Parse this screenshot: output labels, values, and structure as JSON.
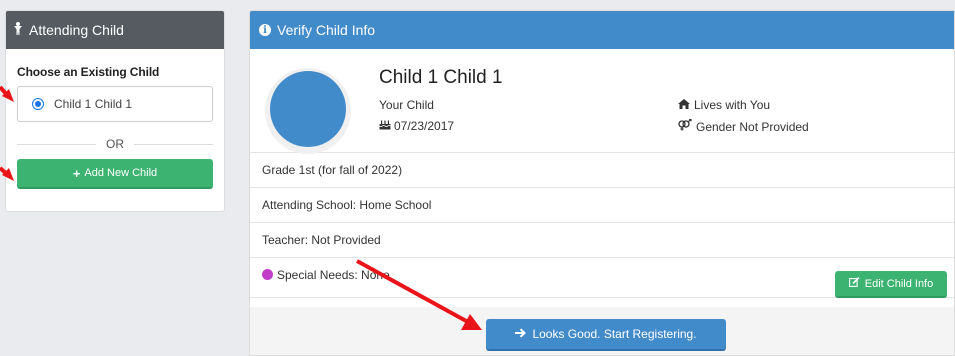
{
  "left_panel": {
    "title": "Attending Child",
    "choose_label": "Choose an Existing Child",
    "existing_child": "Child 1 Child 1",
    "or_text": "OR",
    "add_button": "Add New Child"
  },
  "right_panel": {
    "title": "Verify Child Info",
    "child_name": "Child 1 Child 1",
    "relationship": "Your Child",
    "birthdate": "07/23/2017",
    "living": "Lives with You",
    "gender": "Gender Not Provided",
    "grade": "Grade 1st (for fall of 2022)",
    "school": "Attending School:  Home School",
    "teacher": "Teacher:  Not Provided",
    "special_needs": "Special Needs:  None",
    "edit_button": "Edit Child Info",
    "start_button": "Looks Good. Start Registering."
  },
  "colors": {
    "primary": "#428bca",
    "success": "#3cb371",
    "header_dark": "#555b61",
    "annotation_arrow": "#e8141a",
    "special_needs_icon": "#c13ec9"
  }
}
